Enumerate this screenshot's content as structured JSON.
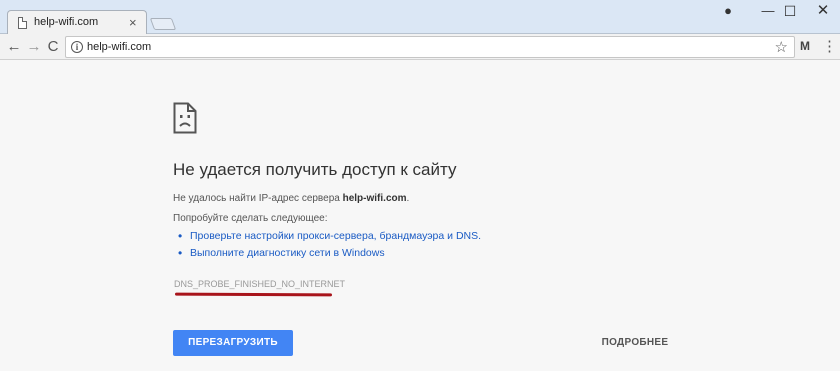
{
  "tab": {
    "title": "help-wifi.com",
    "close": "×"
  },
  "window": {
    "profile": "●",
    "minimize": "—",
    "maximize": "☐",
    "close": "✕"
  },
  "toolbar": {
    "back": "←",
    "forward": "→",
    "reload": "C",
    "info": "i",
    "url": "help-wifi.com",
    "star": "☆",
    "extension": "M",
    "menu": "⋮"
  },
  "error": {
    "heading": "Не удается получить доступ к сайту",
    "subtitle_prefix": "Не удалось найти IP-адрес сервера ",
    "subtitle_host": "help-wifi.com",
    "subtitle_suffix": ".",
    "try_label": "Попробуйте сделать следующее:",
    "suggestions": [
      "Проверьте настройки прокси-сервера, брандмауэра и DNS.",
      "Выполните диагностику сети в Windows"
    ],
    "code": "DNS_PROBE_FINISHED_NO_INTERNET",
    "reload_button": "ПЕРЕЗАГРУЗИТЬ",
    "details_button": "ПОДРОБНЕЕ"
  },
  "colors": {
    "accent": "#4285f4",
    "link": "#1a5bc4",
    "mark": "#a8141b"
  }
}
